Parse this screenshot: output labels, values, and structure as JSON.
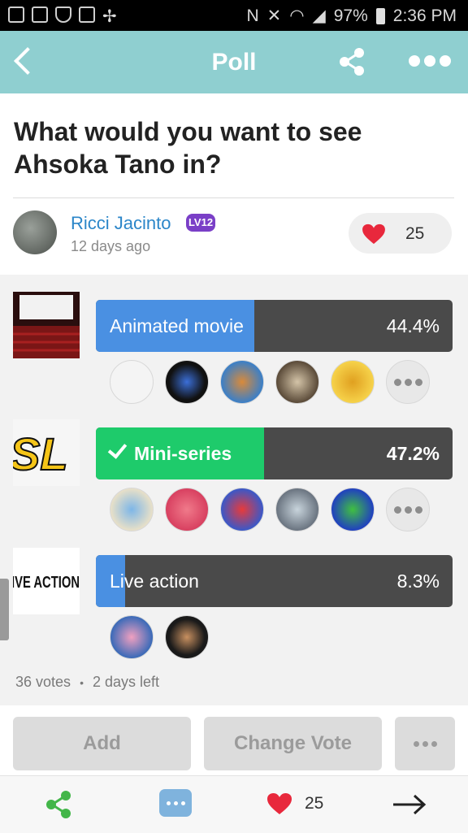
{
  "status_bar": {
    "battery": "97%",
    "time": "2:36 PM"
  },
  "header": {
    "title": "Poll"
  },
  "poll": {
    "question": "What would you want to see Ahsoka Tano in?",
    "author": {
      "name": "Ricci Jacinto",
      "level": "LV12",
      "time": "12 days ago"
    },
    "likes": "25",
    "options": [
      {
        "label": "Animated movie",
        "percent": "44.4%",
        "fraction": 0.444,
        "selected": false,
        "color": "#4a90e2"
      },
      {
        "label": "Mini-series",
        "percent": "47.2%",
        "fraction": 0.472,
        "selected": true,
        "color": "#1ecb6b"
      },
      {
        "label": "Live action",
        "percent": "8.3%",
        "fraction": 0.083,
        "selected": false,
        "color": "#4a90e2"
      }
    ],
    "thumb_text": {
      "option2": "SL",
      "option3": "IVE ACTION"
    },
    "votes": "36 votes",
    "separator": "•",
    "time_left": "2 days left"
  },
  "actions": {
    "add": "Add",
    "change_vote": "Change Vote"
  },
  "bottom_bar": {
    "likes": "25"
  }
}
